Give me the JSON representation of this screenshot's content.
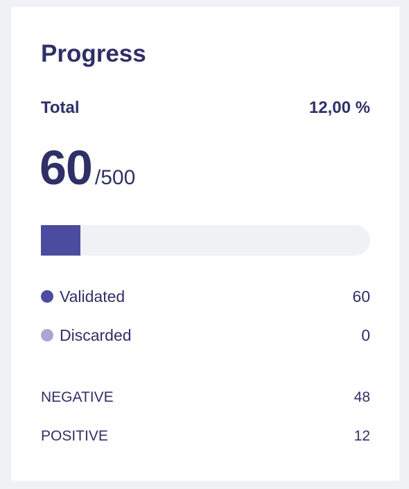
{
  "progress": {
    "title": "Progress",
    "total_label": "Total",
    "total_percent": "12,00 %",
    "current": "60",
    "of_total": "/500",
    "fraction": 0.12,
    "fill_color": "#4b4b9f",
    "track_color": "#f0f1f5"
  },
  "legend": [
    {
      "label": "Validated",
      "value": "60",
      "color": "#4b4b9f"
    },
    {
      "label": "Discarded",
      "value": "0",
      "color": "#a7a7d1"
    }
  ],
  "classes": [
    {
      "label": "NEGATIVE",
      "value": "48"
    },
    {
      "label": "POSITIVE",
      "value": "12"
    }
  ]
}
